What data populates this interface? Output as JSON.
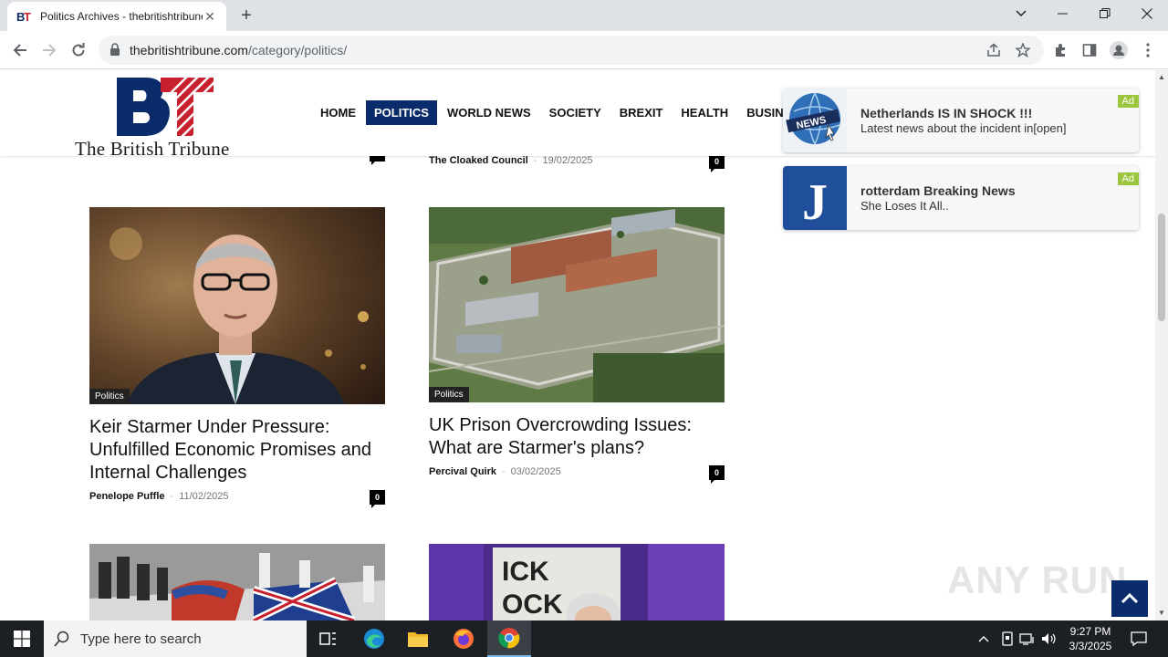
{
  "browser": {
    "tab_title": "Politics Archives - thebritishtribune",
    "url_host": "thebritishtribune.com",
    "url_path": "/category/politics/"
  },
  "site": {
    "logo_letters": "BT",
    "logo_tagline": "The British Tribune",
    "nav": [
      "HOME",
      "POLITICS",
      "WORLD NEWS",
      "SOCIETY",
      "BREXIT",
      "HEALTH",
      "BUSINESS"
    ],
    "active_nav": "POLITICS",
    "colors": {
      "navy": "#0b2c6b",
      "red": "#c8202f",
      "ad_badge": "#9bc53d"
    }
  },
  "ads": [
    {
      "title": "Netherlands IS IN SHOCK !!!",
      "subtitle": "Latest news about the incident in[open]",
      "badge": "Ad",
      "thumb_icon": "news-globe-icon"
    },
    {
      "title": "rotterdam Breaking News",
      "subtitle": "She Loses It All..",
      "badge": "Ad",
      "thumb_icon": "j-letter-icon"
    }
  ],
  "posts_top_partial": [
    {
      "author": "The Cloaked Council",
      "date": "19/02/2025",
      "comments": "0"
    }
  ],
  "posts": [
    {
      "category": "Politics",
      "title": "Keir Starmer Under Pressure: Unfulfilled Economic Promises and Internal Challenges",
      "author": "Penelope Puffle",
      "date": "11/02/2025",
      "comments": "0"
    },
    {
      "category": "Politics",
      "title": "UK Prison Overcrowding Issues: What are Starmer's plans?",
      "author": "Percival Quirk",
      "date": "03/02/2025",
      "comments": "0"
    }
  ],
  "watermark": "ANY RUN",
  "taskbar": {
    "search_placeholder": "Type here to search",
    "time": "9:27 PM",
    "date": "3/3/2025"
  }
}
